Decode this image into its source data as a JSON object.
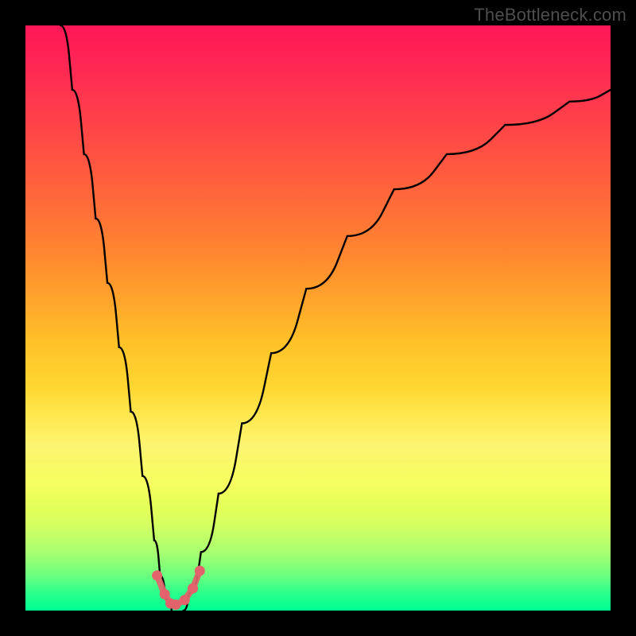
{
  "watermark": {
    "text": "TheBottleneck.com"
  },
  "colors": {
    "frame": "#000000",
    "curve": "#000000",
    "markers": "#e2636b"
  },
  "chart_data": {
    "type": "line",
    "title": "",
    "xlabel": "",
    "ylabel": "",
    "xlim": [
      0,
      100
    ],
    "ylim": [
      0,
      100
    ],
    "note": "No numeric axis ticks are rendered; x/y are normalized 0–100 across the plot area. Two curves form a V (bottleneck) with minimum near x≈25.",
    "series": [
      {
        "name": "left-branch",
        "x": [
          6,
          8,
          10,
          12,
          14,
          16,
          18,
          20,
          22,
          23,
          24,
          25
        ],
        "y": [
          100,
          89,
          78,
          67,
          56,
          45,
          34,
          23,
          12,
          6,
          2,
          0
        ]
      },
      {
        "name": "right-branch",
        "x": [
          27,
          28,
          30,
          33,
          37,
          42,
          48,
          55,
          63,
          72,
          82,
          93,
          100
        ],
        "y": [
          0,
          3,
          10,
          20,
          32,
          44,
          55,
          64,
          72,
          78,
          83,
          87,
          89
        ]
      }
    ],
    "markers": {
      "name": "valley-markers",
      "x": [
        22.5,
        23.8,
        24.8,
        25.7,
        27.2,
        28.6,
        29.8
      ],
      "y": [
        6.0,
        2.8,
        1.2,
        1.0,
        1.8,
        3.8,
        6.8
      ]
    }
  }
}
